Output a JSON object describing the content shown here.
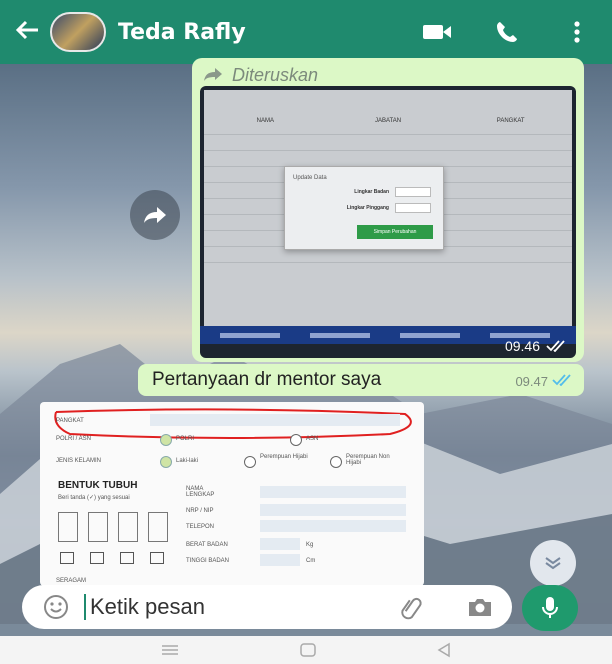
{
  "header": {
    "contact_name": "Teda Rafly",
    "back_icon": "back-arrow-icon",
    "video_icon": "video-call-icon",
    "call_icon": "phone-icon",
    "menu_icon": "more-vert-icon",
    "color": "#1f8a6e"
  },
  "messages": {
    "forwarded_label": "Diteruskan",
    "forwarded_time": "09.46",
    "text_message": "Pertanyaan dr mentor saya",
    "text_time": "09.47"
  },
  "photo_screen": {
    "dialog_title": "Update Data",
    "field_1": "Lingkar Badan",
    "field_2": "Lingkar Pinggang",
    "button": "Simpan Perubahan"
  },
  "document": {
    "pangkat_label": "PANGKAT",
    "polri_asn_label": "POLRI / ASN",
    "opt_polri": "POLRI",
    "opt_asn": "ASN",
    "gender_label": "JENIS KELAMIN",
    "opt_male": "Laki-laki",
    "opt_female_hijab": "Perempuan Hijabi",
    "opt_female_nonhijab": "Perempuan Non Hijabi",
    "body_heading": "BENTUK TUBUH",
    "body_note": "Beri tanda (✓) yang sesuai",
    "name_label": "NAMA LENGKAP",
    "nrp_label": "NRP / NIP",
    "phone_label": "TELEPON",
    "weight_label": "BERAT BADAN",
    "weight_unit": "Kg",
    "height_label": "TINGGI BADAN",
    "height_unit": "Cm",
    "seragam_label": "SERAGAM"
  },
  "input": {
    "placeholder": "Ketik pesan"
  }
}
